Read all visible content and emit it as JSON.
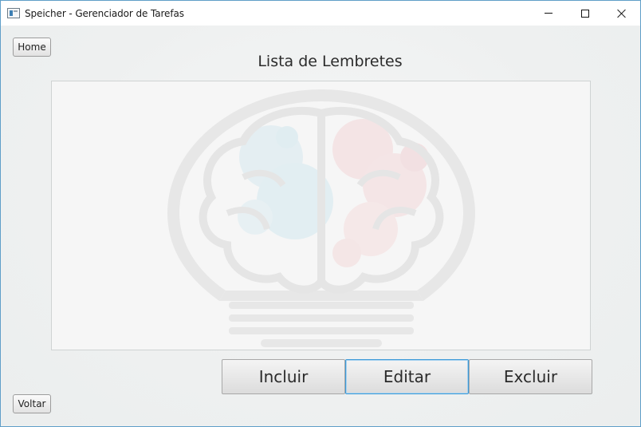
{
  "window": {
    "title": "Speicher - Gerenciador de Tarefas",
    "controls": {
      "minimize_icon": "minimize-icon",
      "maximize_icon": "maximize-icon",
      "close_icon": "close-icon"
    }
  },
  "nav": {
    "home_label": "Home",
    "back_label": "Voltar"
  },
  "main": {
    "title": "Lista de Lembretes",
    "list_items": [],
    "watermark_icon": "brain-lightbulb-logo"
  },
  "actions": {
    "add_label": "Incluir",
    "edit_label": "Editar",
    "delete_label": "Excluir"
  },
  "colors": {
    "focus_border": "#3d9ad8",
    "window_border": "#5f9ec8"
  }
}
